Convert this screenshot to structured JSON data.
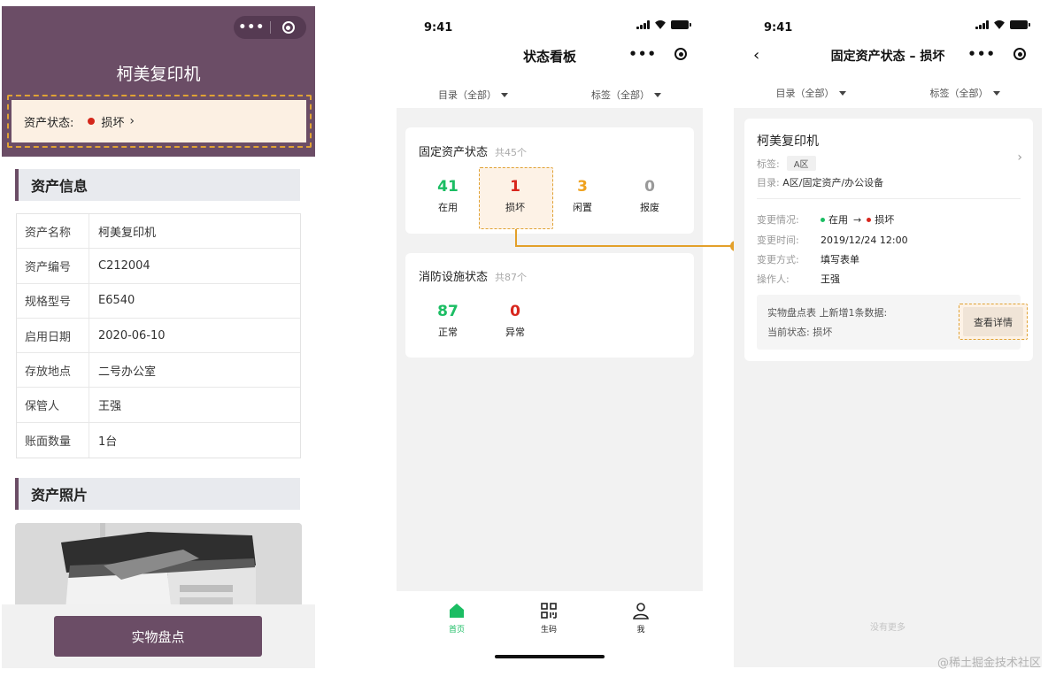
{
  "detail_screen": {
    "title": "柯美复印机",
    "status_label": "资产状态:",
    "status_value": "损坏",
    "info_section_title": "资产信息",
    "info_rows": [
      {
        "label": "资产名称",
        "value": "柯美复印机"
      },
      {
        "label": "资产编号",
        "value": "C212004"
      },
      {
        "label": "规格型号",
        "value": "E6540"
      },
      {
        "label": "启用日期",
        "value": "2020-06-10"
      },
      {
        "label": "存放地点",
        "value": "二号办公室"
      },
      {
        "label": "保管人",
        "value": "王强"
      },
      {
        "label": "账面数量",
        "value": "1台"
      }
    ],
    "photo_section_title": "资产照片",
    "action_button": "实物盘点"
  },
  "dashboard_screen": {
    "time": "9:41",
    "title": "状态看板",
    "filters": [
      "目录（全部）",
      "标签（全部）"
    ],
    "fixed_asset": {
      "title": "固定资产状态",
      "count": "共45个",
      "stats": [
        {
          "num": "41",
          "label": "在用",
          "color": "#1bbd63"
        },
        {
          "num": "1",
          "label": "损坏",
          "color": "#d8261d"
        },
        {
          "num": "3",
          "label": "闲置",
          "color": "#efa21f"
        },
        {
          "num": "0",
          "label": "报废",
          "color": "#999999"
        }
      ]
    },
    "fire_facility": {
      "title": "消防设施状态",
      "count": "共87个",
      "stats": [
        {
          "num": "87",
          "label": "正常",
          "color": "#1bbd63"
        },
        {
          "num": "0",
          "label": "异常",
          "color": "#d8261d"
        }
      ]
    },
    "tabs": [
      {
        "label": "首页",
        "icon": "home-icon"
      },
      {
        "label": "生码",
        "icon": "qr-code-icon"
      },
      {
        "label": "我",
        "icon": "user-icon"
      }
    ]
  },
  "status_list_screen": {
    "time": "9:41",
    "title": "固定资产状态 – 损坏",
    "filters": [
      "目录（全部）",
      "标签（全部）"
    ],
    "record": {
      "name": "柯美复印机",
      "tag_label": "标签:",
      "tag_value": "A区",
      "catalog_label": "目录:",
      "catalog_value": "A区/固定资产/办公设备",
      "change_label": "变更情况:",
      "change_from": "在用",
      "change_arrow": "→",
      "change_to": "损坏",
      "time_label": "变更时间:",
      "time_value": "2019/12/24 12:00",
      "method_label": "变更方式:",
      "method_value": "填写表单",
      "operator_label": "操作人:",
      "operator_value": "王强",
      "note_line1": "实物盘点表 上新增1条数据:",
      "note_line2": "当前状态: 损坏",
      "detail_button": "查看详情"
    },
    "no_more": "没有更多"
  },
  "watermark": "@稀土掘金技术社区",
  "colors": {
    "brand_purple": "#6b4d66",
    "highlight_orange": "#e3a02a",
    "green": "#1bbd63",
    "red": "#d8261d"
  }
}
